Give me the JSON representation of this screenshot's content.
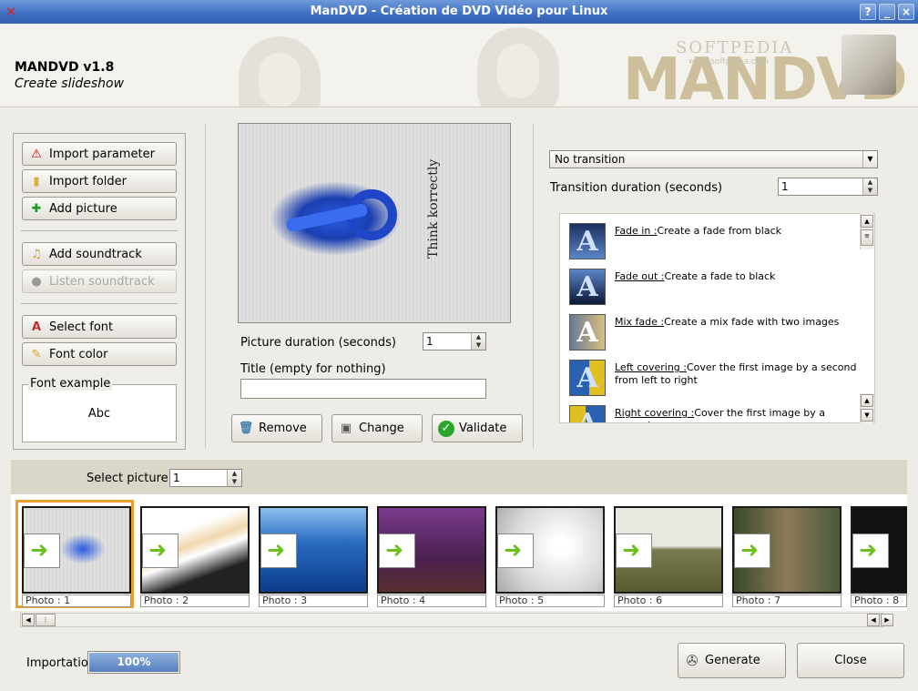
{
  "window": {
    "title": "ManDVD - Création de DVD Vidéo pour Linux",
    "controls": [
      "?",
      "_",
      "□",
      "×"
    ]
  },
  "header": {
    "app_name": "MANDVD v1.8",
    "subtitle": "Create slideshow",
    "watermark": "SOFTPEDIA",
    "watermark_url": "www.softpedia.com",
    "logo_text": "MANDVD"
  },
  "left_panel": {
    "import_parameter": "Import parameter",
    "import_folder": "Import folder",
    "add_picture": "Add picture",
    "add_soundtrack": "Add soundtrack",
    "listen_soundtrack": "Listen soundtrack",
    "select_font": "Select font",
    "font_color": "Font color",
    "font_example_label": "Font example",
    "font_example_text": "Abc"
  },
  "center": {
    "preview_text": "Think korrectly",
    "picture_duration_label": "Picture duration (seconds)",
    "picture_duration_value": "1",
    "title_label": "Title (empty for nothing)",
    "title_value": "",
    "remove": "Remove",
    "change": "Change",
    "validate": "Validate"
  },
  "right_panel": {
    "transition_selected": "No transition",
    "transition_duration_label": "Transition duration (seconds)",
    "transition_duration_value": "1",
    "transitions": [
      {
        "name": "Fade in :",
        "desc": "Create a fade from black"
      },
      {
        "name": "Fade out :",
        "desc": "Create a fade to black"
      },
      {
        "name": "Mix fade :",
        "desc": "Create a mix fade with two images"
      },
      {
        "name": "Left covering :",
        "desc": "Cover the first image by a second from left to right"
      },
      {
        "name": "Right covering :",
        "desc": "Cover the first image by a second"
      }
    ]
  },
  "strip": {
    "select_picture_label": "Select picture",
    "select_picture_value": "1",
    "photos": [
      "Photo : 1",
      "Photo : 2",
      "Photo : 3",
      "Photo : 4",
      "Photo : 5",
      "Photo : 6",
      "Photo : 7",
      "Photo : 8"
    ]
  },
  "footer": {
    "importation_label": "Importation",
    "progress_text": "100%",
    "progress_fraction": 1.0,
    "generate": "Generate",
    "close": "Close"
  },
  "colors": {
    "titlebar": "#3d6ec2",
    "selected_photo_border": "#e8a030",
    "progress_fill": "#5580bd"
  }
}
